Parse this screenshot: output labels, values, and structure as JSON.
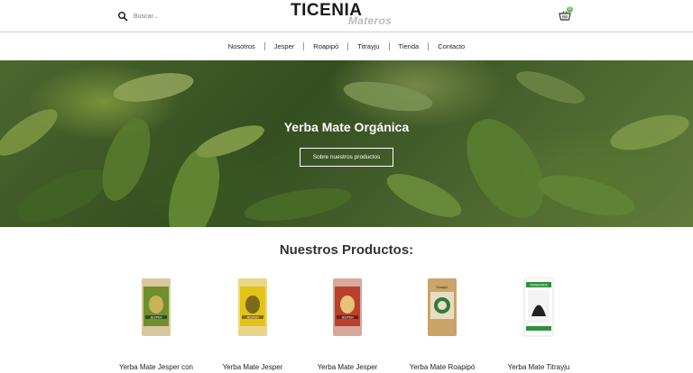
{
  "header": {
    "search_placeholder": "Buscar...",
    "logo_main": "TICENIA",
    "logo_sub": "Materos",
    "cart_count": "0"
  },
  "nav": {
    "items": [
      "Nosotros",
      "Jesper",
      "Roapipó",
      "Titrayju",
      "Tienda",
      "Contacto"
    ]
  },
  "hero": {
    "title": "Yerba Mate Orgánica",
    "button_label": "Sobre nuestros productos"
  },
  "products": {
    "section_title": "Nuestros Productos:",
    "items": [
      {
        "name": "Yerba Mate Jesper con",
        "package_color": "#6f8f2e",
        "package_label": "JESPER"
      },
      {
        "name": "Yerba Mate Jesper",
        "package_color": "#e3c21a",
        "package_label": "JESPER"
      },
      {
        "name": "Yerba Mate Jesper",
        "package_color": "#b9402b",
        "package_label": "JESPER"
      },
      {
        "name": "Yerba Mate Roapipó",
        "package_color": "#c9a56a",
        "package_label": "Roapipó"
      },
      {
        "name": "Yerba Mate Titrayju",
        "package_color": "#ffffff",
        "package_label": "YERBA MATE"
      }
    ]
  },
  "colors": {
    "accent": "#6bbf59",
    "divider": "#cfcfcf"
  }
}
